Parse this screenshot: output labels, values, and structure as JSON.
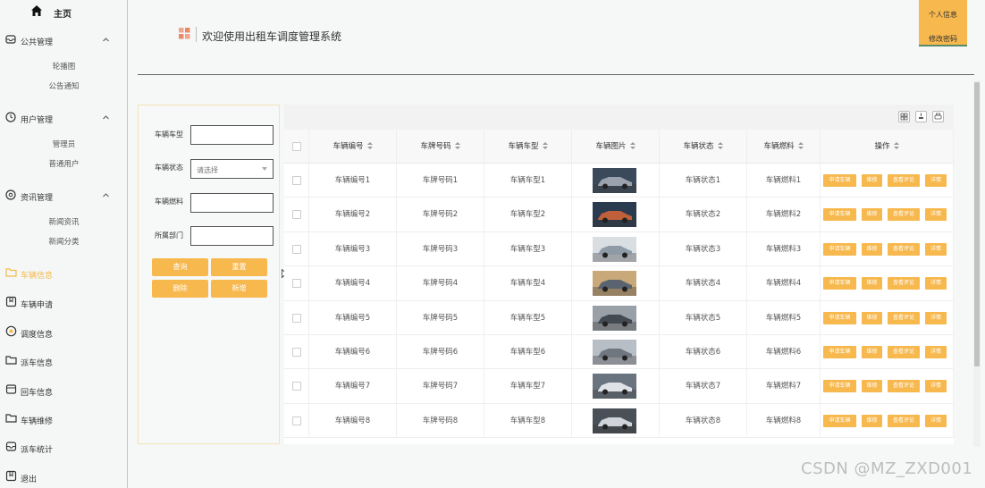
{
  "sidebar": {
    "home_label": "主页",
    "groups": [
      {
        "label": "公共管理",
        "subs": [
          "轮播图",
          "公告通知"
        ]
      },
      {
        "label": "用户管理",
        "subs": [
          "管理员",
          "普通用户"
        ]
      },
      {
        "label": "资讯管理",
        "subs": [
          "新闻资讯",
          "新闻分类"
        ]
      }
    ],
    "items": [
      "车辆信息",
      "车辆申请",
      "调度信息",
      "派车信息",
      "回车信息",
      "车辆维修",
      "派车统计",
      "退出"
    ]
  },
  "header": {
    "title": "欢迎使用出租车调度管理系统",
    "user_info": "个人信息",
    "change_password": "修改密码"
  },
  "search": {
    "type_label": "车辆车型",
    "status_label": "车辆状态",
    "status_placeholder": "请选择",
    "fuel_label": "车辆燃料",
    "dept_label": "所属部门",
    "query": "查询",
    "reset": "重置",
    "delete": "删除",
    "add": "新增"
  },
  "table": {
    "columns": [
      "车辆编号",
      "车牌号码",
      "车辆车型",
      "车辆图片",
      "车辆状态",
      "车辆燃料",
      "操作"
    ],
    "actions": [
      "申请车辆",
      "维修",
      "查看评论",
      "详情"
    ],
    "rows": [
      {
        "no": "车辆编号1",
        "plate": "车牌号码1",
        "type": "车辆车型1",
        "status": "车辆状态1",
        "fuel": "车辆燃料1"
      },
      {
        "no": "车辆编号2",
        "plate": "车牌号码2",
        "type": "车辆车型2",
        "status": "车辆状态2",
        "fuel": "车辆燃料2"
      },
      {
        "no": "车辆编号3",
        "plate": "车牌号码3",
        "type": "车辆车型3",
        "status": "车辆状态3",
        "fuel": "车辆燃料3"
      },
      {
        "no": "车辆编号4",
        "plate": "车牌号码4",
        "type": "车辆车型4",
        "status": "车辆状态4",
        "fuel": "车辆燃料4"
      },
      {
        "no": "车辆编号5",
        "plate": "车牌号码5",
        "type": "车辆车型5",
        "status": "车辆状态5",
        "fuel": "车辆燃料5"
      },
      {
        "no": "车辆编号6",
        "plate": "车牌号码6",
        "type": "车辆车型6",
        "status": "车辆状态6",
        "fuel": "车辆燃料6"
      },
      {
        "no": "车辆编号7",
        "plate": "车牌号码7",
        "type": "车辆车型7",
        "status": "车辆状态7",
        "fuel": "车辆燃料7"
      },
      {
        "no": "车辆编号8",
        "plate": "车牌号码8",
        "type": "车辆车型8",
        "status": "车辆状态8",
        "fuel": "车辆燃料8"
      }
    ]
  },
  "watermark": "CSDN @MZ_ZXD001",
  "colors": {
    "accent": "#f7b84e",
    "sidebar_border": "#f5c162",
    "active_text": "#f5b94a"
  }
}
